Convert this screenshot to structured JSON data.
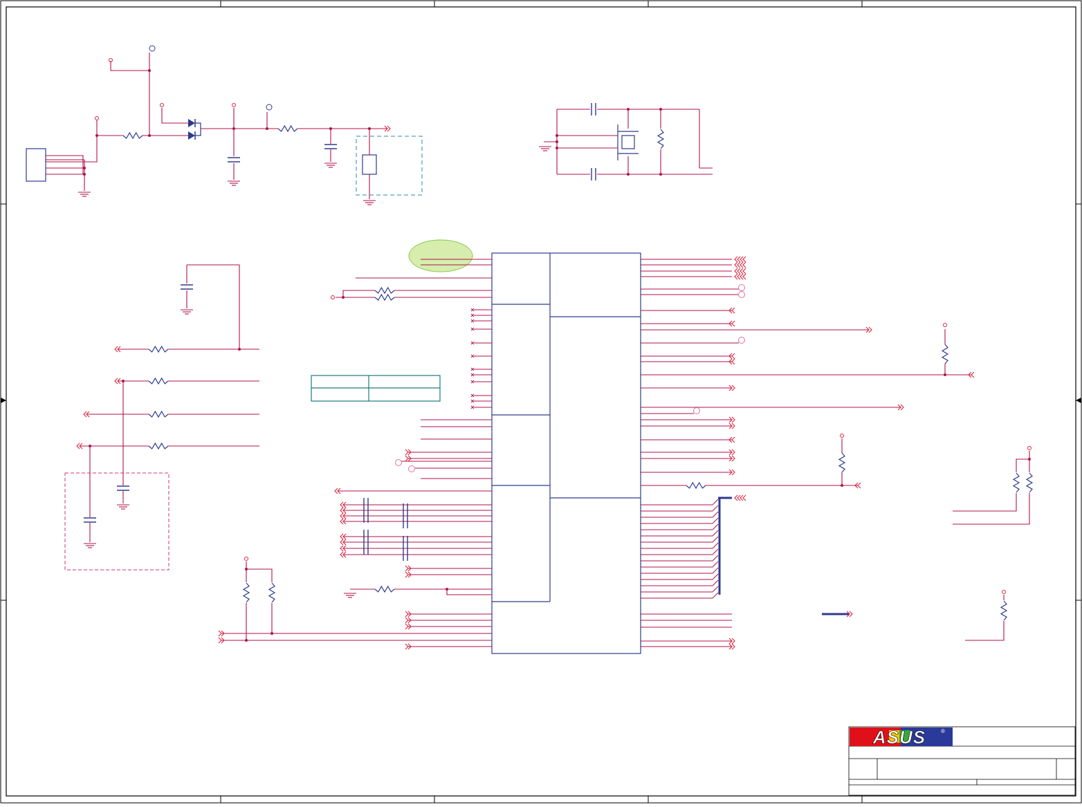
{
  "sheet": {
    "title": "",
    "brand": "ASUS",
    "registered_mark": "®"
  },
  "colors": {
    "wire": "#b0124a",
    "component": "#2e3a8c",
    "net_arrow": "#e0203a",
    "border": "#000000",
    "teal_box": "#1a7a7a",
    "dashed_blue": "#2a8aa8",
    "dashed_pink": "#d0307a",
    "highlight_green": "#b7e07a",
    "logo_red": "#e0101a",
    "logo_blue": "#2a3a9a"
  },
  "icons": {
    "diode": "diode-icon",
    "resistor": "resistor-icon",
    "capacitor": "capacitor-icon",
    "ground": "ground-icon",
    "crystal": "crystal-icon",
    "off_page_connector": "off-page-connector-icon"
  }
}
